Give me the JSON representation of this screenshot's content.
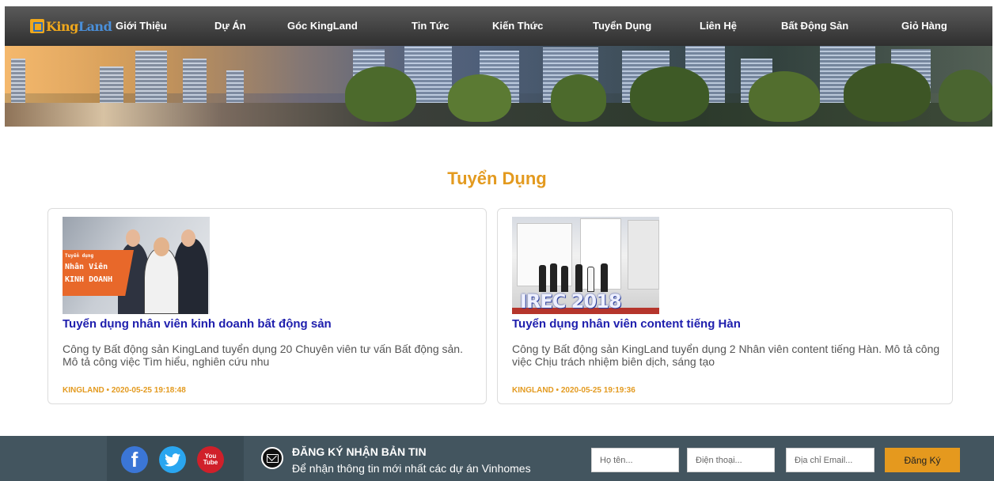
{
  "brand": {
    "logo_part1": "King",
    "logo_part2": "Land"
  },
  "nav": {
    "items": [
      {
        "label": "Giới Thiệu"
      },
      {
        "label": "Dự Án"
      },
      {
        "label": "Góc KingLand"
      },
      {
        "label": "Tin Tức"
      },
      {
        "label": "Kiến Thức"
      },
      {
        "label": "Tuyển Dụng"
      },
      {
        "label": "Liên Hệ"
      },
      {
        "label": "Bất Động Sản"
      },
      {
        "label": "Giỏ Hàng"
      }
    ]
  },
  "main": {
    "title": "Tuyển Dụng",
    "posts": [
      {
        "title": "Tuyển dụng nhân viên kinh doanh bất động sản",
        "description": "Công ty Bất động sản KingLand tuyển dụng 20 Chuyên viên tư vấn Bất động sản. Mô tả công việc Tìm hiểu, nghiên cứu nhu",
        "meta": "KINGLAND • 2020-05-25 19:18:48",
        "image": {
          "line1": "Tuyển dụng",
          "line2": "Nhân Viên",
          "line3": "KINH DOANH"
        }
      },
      {
        "title": "Tuyển dụng nhân viên content tiếng Hàn",
        "description": "Công ty Bất động sản KingLand tuyển dụng 2 Nhân viên content tiếng Hàn. Mô tả công việc Chịu trách nhiệm biên dịch, sáng tạo",
        "meta": "KINGLAND • 2020-05-25 19:19:36",
        "image": {
          "text": "IREC 2018"
        }
      }
    ]
  },
  "footer": {
    "social": {
      "youtube_line1": "You",
      "youtube_line2": "Tube",
      "facebook_glyph": "f",
      "twitter_glyph": "🐦"
    },
    "newsletter": {
      "title": "ĐĂNG KÝ NHẬN BẢN TIN",
      "subtitle": "Để nhận thông tin mới nhất các dự án Vinhomes"
    },
    "form": {
      "name_placeholder": "Họ tên...",
      "phone_placeholder": "Điện thoại...",
      "email_placeholder": "Địa chỉ Email...",
      "submit_label": "Đăng Ký"
    }
  },
  "colors": {
    "accent": "#e39a1f",
    "link": "#1e1ead",
    "footer_bg": "#43555f",
    "nav_bg": "#3a3a3a"
  }
}
